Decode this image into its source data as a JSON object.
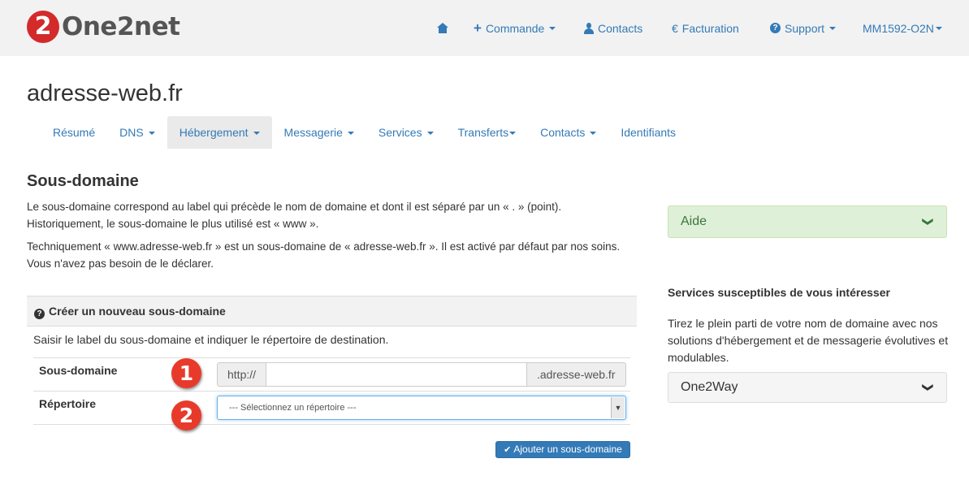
{
  "brand": {
    "logo_text": "One2net",
    "logo_mark": "2"
  },
  "topnav": {
    "home_icon": "home-icon",
    "commande": "Commande",
    "contacts": "Contacts",
    "facturation": "Facturation",
    "facturation_symbol": "€",
    "support": "Support",
    "account": "MM1592-O2N"
  },
  "domain": {
    "title": "adresse-web.fr"
  },
  "tabs": [
    {
      "label": "Résumé"
    },
    {
      "label": "DNS"
    },
    {
      "label": "Hébergement"
    },
    {
      "label": "Messagerie"
    },
    {
      "label": "Services"
    },
    {
      "label": "Transferts"
    },
    {
      "label": "Contacts"
    },
    {
      "label": "Identifiants"
    }
  ],
  "main": {
    "section_title": "Sous-domaine",
    "para1": "Le sous-domaine correspond au label qui précède le nom de domaine et dont il est séparé par un « . » (point). Historiquement, le sous-domaine le plus utilisé est « www ».",
    "para2": "Techniquement « www.adresse-web.fr » est un sous-domaine de « adresse-web.fr ». Il est activé par défaut par nos soins. Vous n'avez pas besoin de le déclarer.",
    "panel_title": "Créer un nouveau sous-domaine",
    "panel_desc": "Saisir le label du sous-domaine et indiquer le répertoire de destination.",
    "subdomain_label": "Sous-domaine",
    "prefix": "http://",
    "suffix": ".adresse-web.fr",
    "subdomain_value": "",
    "directory_label": "Répertoire",
    "directory_selected": "--- Sélectionnez un répertoire ---",
    "badge1": "1",
    "badge2": "2",
    "add_button": "Ajouter un sous-domaine"
  },
  "sidebar": {
    "aide": "Aide",
    "services_title": "Services susceptibles de vous intéresser",
    "services_text": "Tirez le plein parti de votre nom de domaine avec nos solutions d'hébergement et de messagerie évolutives et modulables.",
    "one2way": "One2Way"
  },
  "colors": {
    "link": "#337ab7",
    "aide_bg": "#dff0d8",
    "badge": "#e83a2a"
  }
}
